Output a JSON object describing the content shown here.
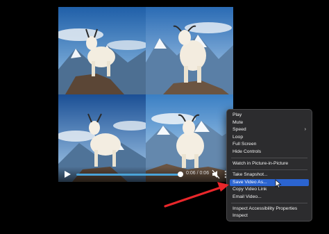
{
  "player": {
    "time_display": "0:06 / 0:06",
    "progress": 1.0,
    "progress_color": "#4aa3d8"
  },
  "context_menu": {
    "groups": [
      [
        {
          "label": "Play"
        },
        {
          "label": "Mute"
        },
        {
          "label": "Speed",
          "has_submenu": true
        },
        {
          "label": "Loop"
        },
        {
          "label": "Full Screen"
        },
        {
          "label": "Hide Controls"
        }
      ],
      [
        {
          "label": "Watch in Picture-in-Picture"
        }
      ],
      [
        {
          "label": "Take Snapshot..."
        },
        {
          "label": "Save Video As...",
          "highlighted": true
        },
        {
          "label": "Copy Video Link"
        },
        {
          "label": "Email Video..."
        }
      ],
      [
        {
          "label": "Inspect Accessibility Properties"
        },
        {
          "label": "Inspect"
        }
      ]
    ],
    "highlight_color": "#2b64d0"
  },
  "annotation": {
    "arrow_color": "#e8262a"
  },
  "icons": {
    "play": "play-icon",
    "mute": "speaker-mute-icon",
    "more": "more-vertical-icon",
    "submenu": "chevron-right-icon",
    "cursor": "mouse-pointer-icon"
  }
}
